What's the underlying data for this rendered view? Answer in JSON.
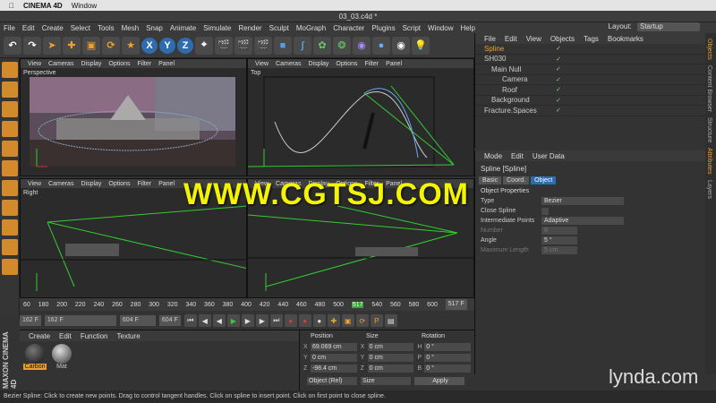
{
  "mac": {
    "app": "CINEMA 4D",
    "window_menu": "Window"
  },
  "window_title": "03_03.c4d *",
  "menu": [
    "File",
    "Edit",
    "Create",
    "Select",
    "Tools",
    "Mesh",
    "Snap",
    "Animate",
    "Simulate",
    "Render",
    "Sculpt",
    "MoGraph",
    "Character",
    "Plugins",
    "Script",
    "Window",
    "Help"
  ],
  "layout": {
    "label": "Layout:",
    "value": "Startup"
  },
  "toolbar_axes": [
    "X",
    "Y",
    "Z"
  ],
  "viewport_menu": [
    "View",
    "Cameras",
    "Display",
    "Options",
    "Filter",
    "Panel"
  ],
  "viewports": {
    "perspective": "Perspective",
    "top": "Top",
    "right": "Right"
  },
  "objects_menu": [
    "File",
    "Edit",
    "View",
    "Objects",
    "Tags",
    "Bookmarks"
  ],
  "objects": [
    {
      "name": "Spline",
      "selected": true
    },
    {
      "name": "SH030"
    },
    {
      "name": "Main Null"
    },
    {
      "name": "Camera"
    },
    {
      "name": "Roof"
    },
    {
      "name": "Background"
    },
    {
      "name": "Fracture.Spaces"
    }
  ],
  "attr_menu": [
    "Mode",
    "Edit",
    "User Data"
  ],
  "attr_title": "Spline [Spline]",
  "attr_tabs": [
    "Basic",
    "Coord.",
    "Object"
  ],
  "attr_section": "Object Properties",
  "attrs": [
    {
      "label": "Type",
      "value": "Bezier"
    },
    {
      "label": "Close Spline",
      "value": ""
    },
    {
      "label": "Intermediate Points",
      "value": "Adaptive"
    },
    {
      "label": "Number",
      "value": "8",
      "dim": true
    },
    {
      "label": "Angle",
      "value": "5 °"
    },
    {
      "label": "Maximum Length",
      "value": "5 cm",
      "dim": true
    }
  ],
  "right_tabs": [
    "Objects",
    "Content Browser",
    "Structure",
    "Attributes",
    "Layers"
  ],
  "timeline_ticks": [
    "60",
    "180",
    "200",
    "220",
    "240",
    "260",
    "280",
    "300",
    "320",
    "340",
    "360",
    "380",
    "400",
    "420",
    "440",
    "460",
    "480",
    "500",
    "517",
    "540",
    "560",
    "580",
    "600"
  ],
  "timeline_current": "517 F",
  "transport": {
    "start": "162 F",
    "current": "162 F",
    "end": "604 F",
    "end2": "604 F"
  },
  "materials_menu": [
    "Create",
    "Edit",
    "Function",
    "Texture"
  ],
  "materials": [
    "Carbon",
    "Mat"
  ],
  "coord_headers": [
    "Position",
    "Size",
    "Rotation"
  ],
  "coords": [
    {
      "pl": "X",
      "pv": "69.069 cm",
      "sl": "X",
      "sv": "0 cm",
      "rl": "H",
      "rv": "0 °"
    },
    {
      "pl": "Y",
      "pv": "0 cm",
      "sl": "Y",
      "sv": "0 cm",
      "rl": "P",
      "rv": "0 °"
    },
    {
      "pl": "Z",
      "pv": "-98.4 cm",
      "sl": "Z",
      "sv": "0 cm",
      "rl": "B",
      "rv": "0 °"
    }
  ],
  "coord_mode": "Object (Rel)",
  "size_mode": "Size",
  "apply": "Apply",
  "status": "Bezier Spline: Click to create new points. Drag to control tangent handles. Click on spline to insert point. Click on first point to close spline.",
  "watermark": "WWW.CGTSJ.COM",
  "brand": "lynda.com",
  "maxon_logo": "MAXON CINEMA 4D"
}
